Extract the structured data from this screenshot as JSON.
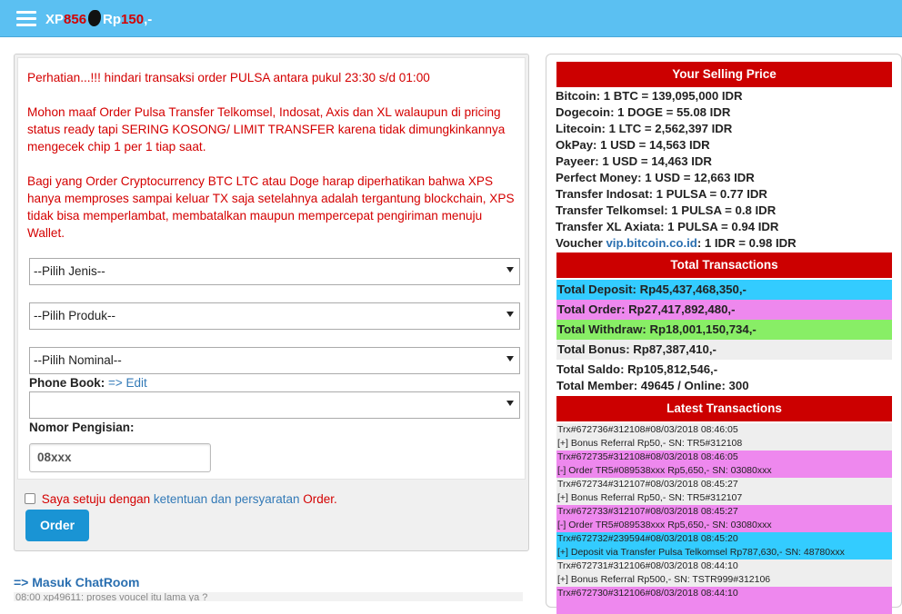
{
  "header": {
    "brand_xp": "XP",
    "brand_xp_red": "856",
    "brand_rp": "Rp",
    "brand_rp_red": "150",
    "brand_tail": ",-"
  },
  "notices": [
    "Perhatian...!!! hindari transaksi order PULSA antara pukul 23:30 s/d 01:00",
    "Mohon maaf Order Pulsa Transfer Telkomsel, Indosat, Axis dan XL walaupun di pricing status ready tapi SERING KOSONG/ LIMIT TRANSFER karena tidak dimungkinkannya mengecek chip 1 per 1 tiap saat.",
    "Bagi yang Order Cryptocurrency BTC LTC atau Doge harap diperhatikan bahwa XPS hanya memproses sampai keluar TX saja setelahnya adalah tergantung blockchain, XPS tidak bisa memperlambat, membatalkan maupun mempercepat pengiriman menuju Wallet."
  ],
  "form": {
    "jenis": "--Pilih Jenis--",
    "produk": "--Pilih Produk--",
    "nominal": "--Pilih Nominal--",
    "phonebook_label": "Phone Book:",
    "phonebook_edit": "=> Edit",
    "phonebook_value": "",
    "nomor_label": "Nomor Pengisian:",
    "nomor_placeholder": "08xxx",
    "agree_prefix": "Saya setuju dengan",
    "agree_link": "ketentuan dan persyaratan",
    "agree_suffix": "Order.",
    "order_button": "Order"
  },
  "chat": {
    "link": "=> Masuk ChatRoom",
    "preview": "08:00  xp49611: proses voucel itu lama ya ?"
  },
  "selling": {
    "title": "Your Selling Price",
    "rows": [
      "Bitcoin: 1 BTC = 139,095,000 IDR",
      "Dogecoin: 1 DOGE = 55.08 IDR",
      "Litecoin: 1 LTC = 2,562,397 IDR",
      "OkPay: 1 USD = 14,563 IDR",
      "Payeer: 1 USD = 14,463 IDR",
      "Perfect Money: 1 USD = 12,663 IDR",
      "Transfer Indosat: 1 PULSA = 0.77 IDR",
      "Transfer Telkomsel: 1 PULSA = 0.8 IDR",
      "Transfer XL Axiata: 1 PULSA = 0.94 IDR"
    ],
    "voucher_prefix": "Voucher",
    "voucher_link": "vip.bitcoin.co.id",
    "voucher_suffix": ": 1 IDR = 0.98 IDR"
  },
  "totals": {
    "title": "Total Transactions",
    "deposit": "Total Deposit: Rp45,437,468,350,-",
    "order": "Total Order: Rp27,417,892,480,-",
    "withdraw": "Total Withdraw: Rp18,001,150,734,-",
    "bonus": "Total Bonus: Rp87,387,410,-",
    "saldo": "Total Saldo: Rp105,812,546,-",
    "member": "Total Member: 49645 / Online: 300"
  },
  "latest": {
    "title": "Latest Transactions",
    "items": [
      {
        "id": "Trx#672736#312108#08/03/2018 08:46:05",
        "desc": "[+] Bonus Referral Rp50,- SN: TR5#312108"
      },
      {
        "id": "Trx#672735#312108#08/03/2018 08:46:05",
        "desc": "[-] Order TR5#089538xxx Rp5,650,- SN: 03080xxx"
      },
      {
        "id": "Trx#672734#312107#08/03/2018 08:45:27",
        "desc": "[+] Bonus Referral Rp50,- SN: TR5#312107"
      },
      {
        "id": "Trx#672733#312107#08/03/2018 08:45:27",
        "desc": "[-] Order TR5#089538xxx Rp5,650,- SN: 03080xxx"
      },
      {
        "id": "Trx#672732#239594#08/03/2018 08:45:20",
        "desc": "[+] Deposit via Transfer Pulsa Telkomsel Rp787,630,- SN: 48780xxx"
      },
      {
        "id": "Trx#672731#312106#08/03/2018 08:44:10",
        "desc": "[+] Bonus Referral Rp500,- SN: TSTR999#312106"
      },
      {
        "id": "Trx#672730#312106#08/03/2018 08:44:10",
        "desc": ""
      }
    ]
  },
  "colors": {
    "topbar": "#5bc0f2",
    "header_red": "#cc0000",
    "notice_red": "#d40000",
    "deposit_bg": "#33ccff",
    "order_bg": "#ee88ee",
    "withdraw_bg": "#88ee66",
    "button_blue": "#1a94d4"
  }
}
